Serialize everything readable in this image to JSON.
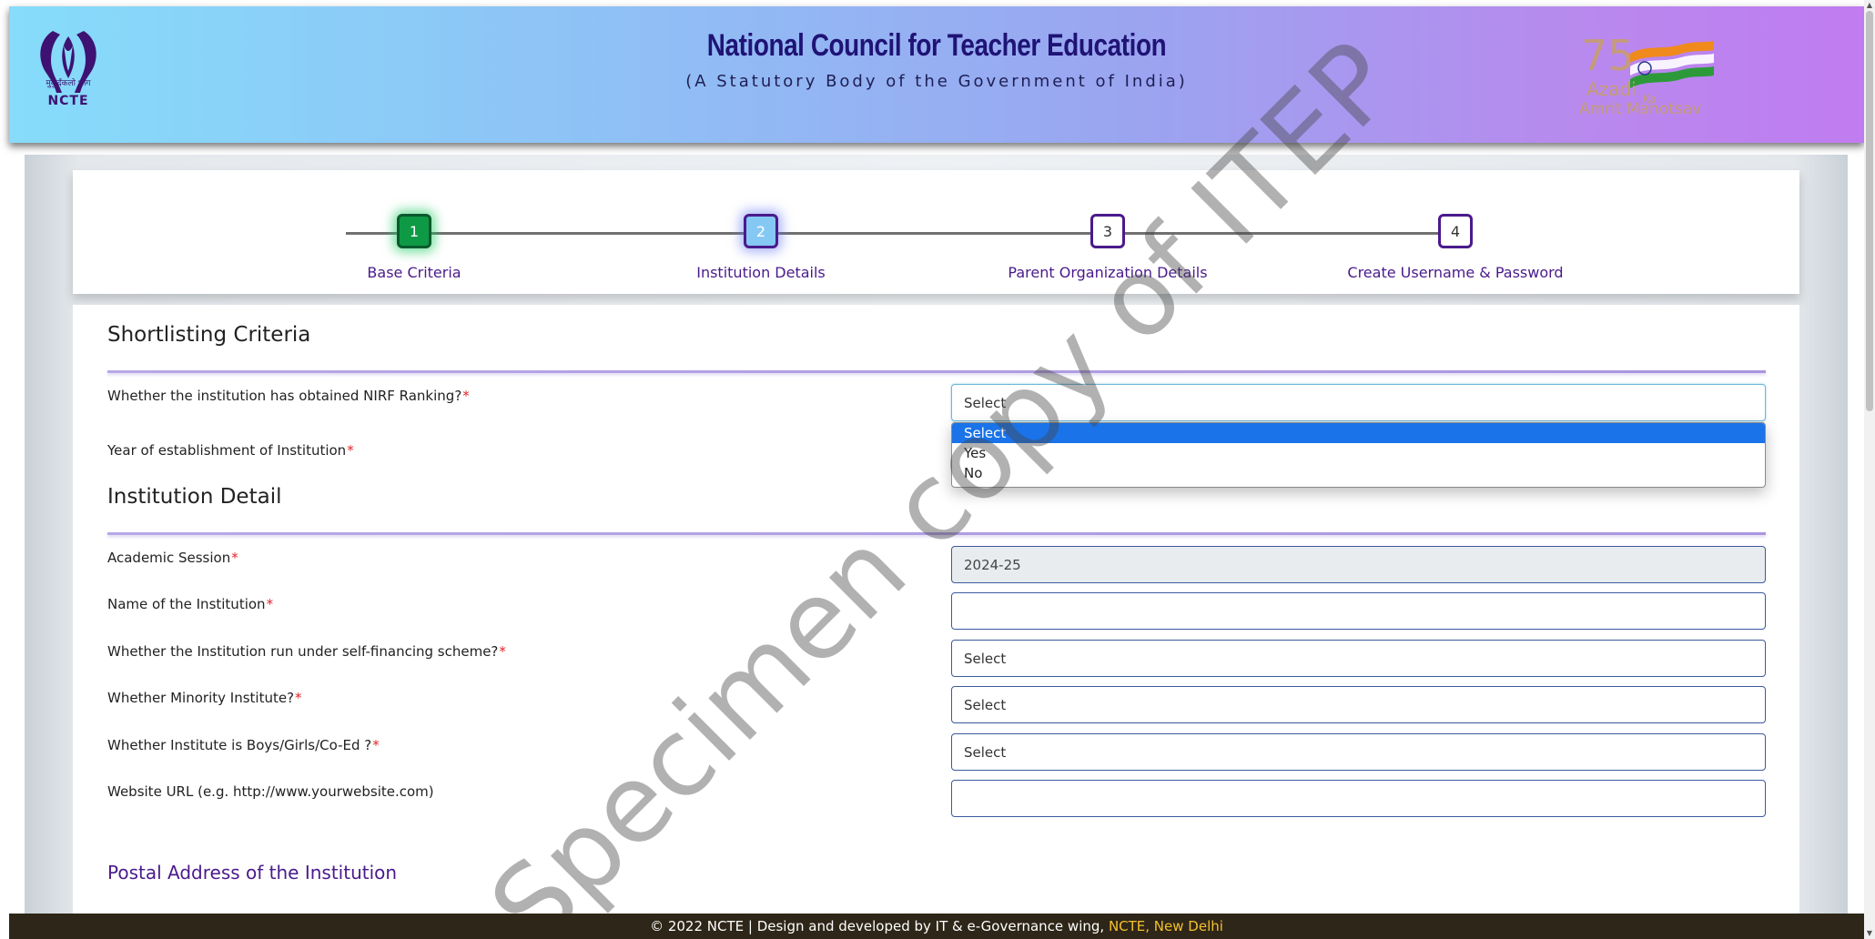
{
  "header": {
    "logo_caption": "मुकुर्दंकलो भाग",
    "logo_name": "NCTE",
    "title": "National Council for Teacher Education",
    "subtitle": "(A Statutory Body of the Government of India)",
    "azadi_line1": "Azadi",
    "azadi_ka": "Ka",
    "azadi_line2": "Amrit Mahotsav"
  },
  "stepper": {
    "steps": [
      {
        "num": "1",
        "label": "Base Criteria",
        "state": "done"
      },
      {
        "num": "2",
        "label": "Institution Details",
        "state": "active"
      },
      {
        "num": "3",
        "label": "Parent Organization Details",
        "state": "pending"
      },
      {
        "num": "4",
        "label": "Create Username & Password",
        "state": "pending"
      }
    ]
  },
  "form": {
    "shortlisting_title": "Shortlisting Criteria",
    "nirf_label": "Whether the institution has obtained NIRF Ranking?",
    "nirf_value": "Select",
    "nirf_options": [
      "Select",
      "Yes",
      "No"
    ],
    "year_label": "Year of establishment of Institution",
    "institution_title": "Institution Detail",
    "session_label": "Academic Session",
    "session_value": "2024-25",
    "name_label": "Name of the Institution",
    "name_value": "",
    "self_financing_label": "Whether the Institution run under self-financing scheme?",
    "self_financing_value": "Select",
    "minority_label": "Whether Minority Institute?",
    "minority_value": "Select",
    "gender_label": "Whether Institute is Boys/Girls/Co-Ed ?",
    "gender_value": "Select",
    "website_label": "Website URL (e.g. http://www.yourwebsite.com)",
    "website_value": "",
    "postal_title": "Postal Address of the Institution",
    "required_mark": "*"
  },
  "footer": {
    "text": "© 2022 NCTE | Design and developed by IT & e-Governance wing, ",
    "highlight": "NCTE, New Delhi"
  },
  "watermark": "Specimen copy of ITEP",
  "colors": {
    "brand_purple": "#4a1a8c",
    "step_done": "#0e9a45",
    "step_active": "#86c8f4",
    "required": "#e0242a",
    "footer_bg": "#2e2618",
    "footer_highlight": "#f5c02a",
    "dropdown_selected": "#1a73e8"
  }
}
